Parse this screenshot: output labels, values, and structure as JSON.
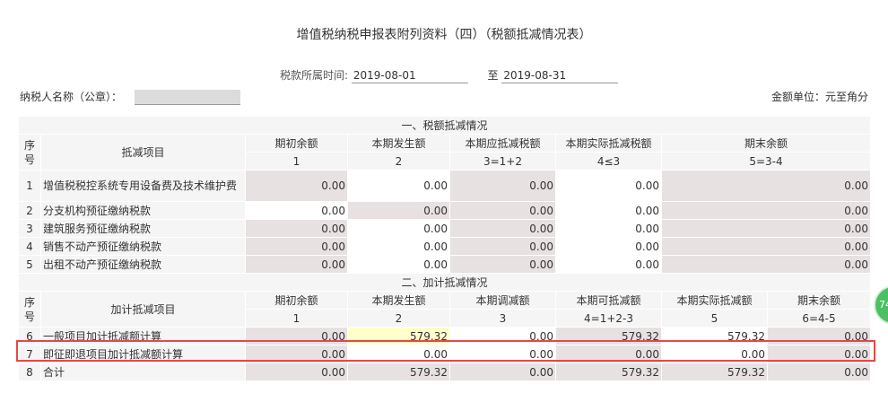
{
  "form_title": "增值税纳税申报表附列资料（四）（税额抵减情况表）",
  "period": {
    "label": "税款所属时间:",
    "start": "2019-08-01",
    "sep": "至",
    "end": "2019-08-31"
  },
  "taxpayer": {
    "label": "纳税人名称（公章）："
  },
  "unit": "金额单位：元至角分",
  "section1": {
    "title": "一、税额抵减情况",
    "seq_header": "序号",
    "item_header": "抵减项目",
    "col_headers": [
      "期初余额",
      "本期发生额",
      "本期应抵减税额",
      "本期实际抵减税额",
      "期末余额"
    ],
    "col_codes": [
      "1",
      "2",
      "3=1+2",
      "4≤3",
      "5=3-4"
    ],
    "rows": [
      {
        "seq": "1",
        "name": "增值税税控系统专用设备费及技术维护费",
        "vals": [
          "0.00",
          "0.00",
          "0.00",
          "0.00",
          "0.00"
        ]
      },
      {
        "seq": "2",
        "name": "分支机构预征缴纳税款",
        "vals": [
          "0.00",
          "0.00",
          "0.00",
          "0.00",
          "0.00"
        ]
      },
      {
        "seq": "3",
        "name": "建筑服务预征缴纳税款",
        "vals": [
          "0.00",
          "0.00",
          "0.00",
          "0.00",
          "0.00"
        ]
      },
      {
        "seq": "4",
        "name": "销售不动产预征缴纳税款",
        "vals": [
          "0.00",
          "0.00",
          "0.00",
          "0.00",
          "0.00"
        ]
      },
      {
        "seq": "5",
        "name": "出租不动产预征缴纳税款",
        "vals": [
          "0.00",
          "0.00",
          "0.00",
          "0.00",
          "0.00"
        ]
      }
    ]
  },
  "section2": {
    "title": "二、加计抵减情况",
    "seq_header": "序号",
    "item_header": "加计抵减项目",
    "col_headers": [
      "期初余额",
      "本期发生额",
      "本期调减额",
      "本期可抵减额",
      "本期实际抵减额",
      "期末余额"
    ],
    "col_codes": [
      "1",
      "2",
      "3",
      "4=1+2-3",
      "5",
      "6=4-5"
    ],
    "rows": [
      {
        "seq": "6",
        "name": "一般项目加计抵减额计算",
        "vals": [
          "0.00",
          "579.32",
          "0.00",
          "579.32",
          "579.32",
          "0.00"
        ]
      },
      {
        "seq": "7",
        "name": "即征即退项目加计抵减额计算",
        "vals": [
          "0.00",
          "0.00",
          "0.00",
          "0.00",
          "0.00",
          "0.00"
        ]
      },
      {
        "seq": "8",
        "name": "合计",
        "vals": [
          "0.00",
          "579.32",
          "0.00",
          "579.32",
          "579.32",
          "0.00"
        ]
      }
    ]
  },
  "side_button": {
    "label": "74"
  }
}
